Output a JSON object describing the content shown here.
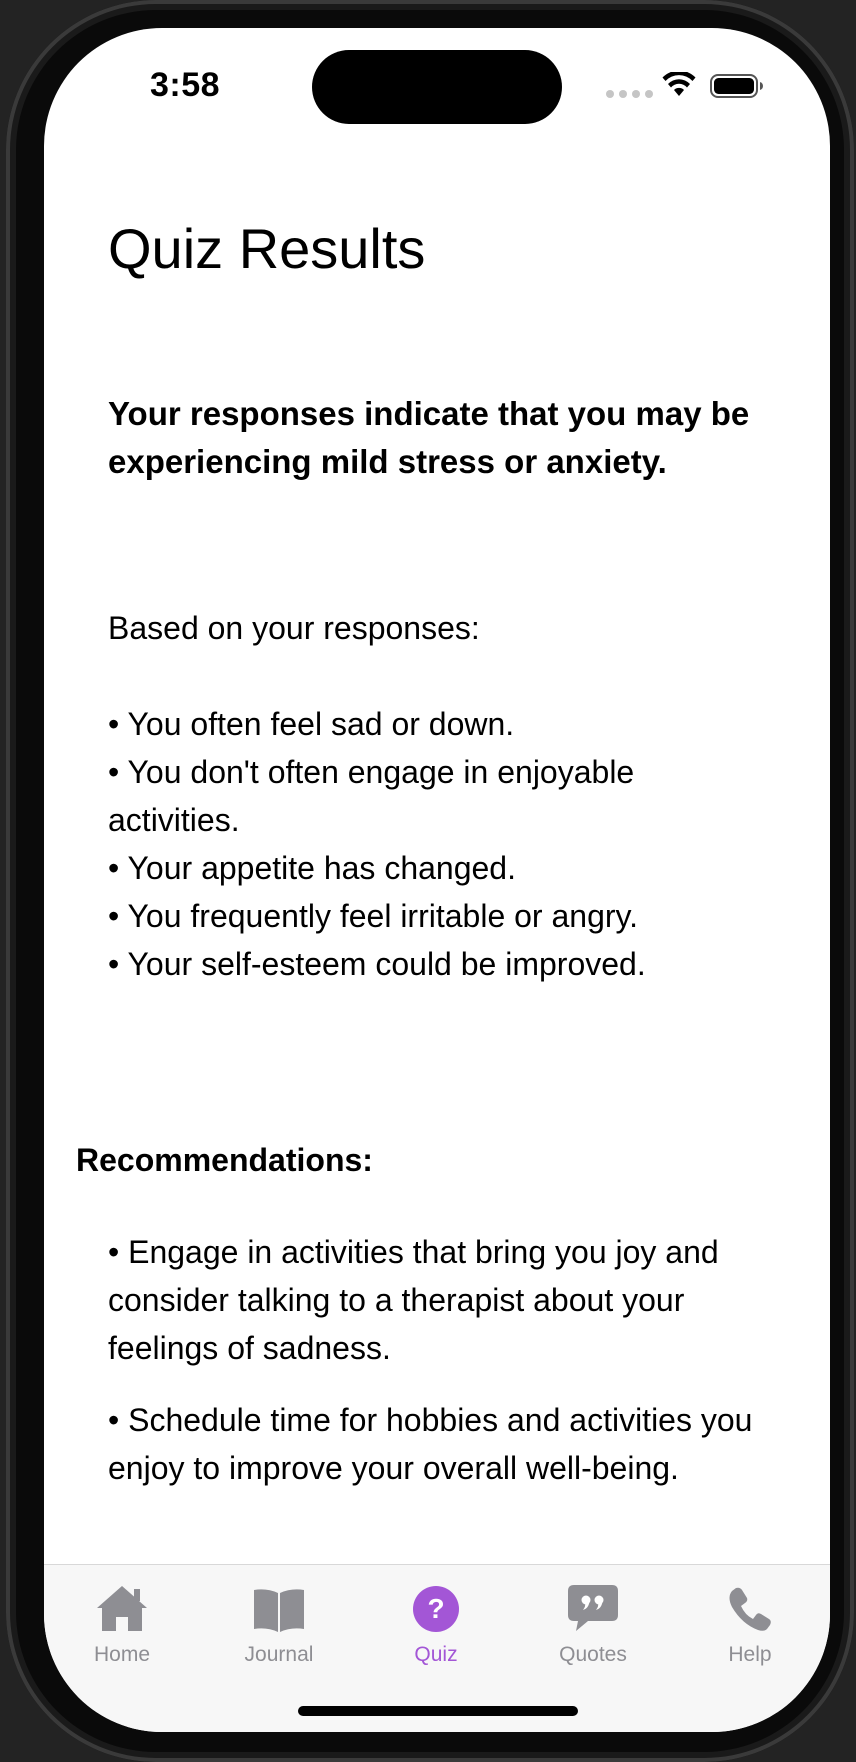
{
  "status_bar": {
    "time": "3:58"
  },
  "page": {
    "title": "Quiz Results",
    "headline": "Your responses indicate that you may be experiencing mild stress or anxiety.",
    "intro": "Based on your responses:",
    "findings": [
      "• You often feel sad or down.",
      "• You don't often engage in enjoyable activities.",
      "• Your appetite has changed.",
      "• You frequently feel irritable or angry.",
      "• Your self-esteem could be improved."
    ],
    "recommendations_heading": "Recommendations:",
    "recommendations": [
      "• Engage in activities that bring you joy and consider talking to a therapist about your feelings of sadness.",
      "• Schedule time for hobbies and activities you enjoy to improve your overall well-being."
    ]
  },
  "tab_bar": {
    "tabs": [
      {
        "label": "Home",
        "icon": "house-icon",
        "active": false
      },
      {
        "label": "Journal",
        "icon": "book-icon",
        "active": false
      },
      {
        "label": "Quiz",
        "icon": "question-circle-icon",
        "active": true
      },
      {
        "label": "Quotes",
        "icon": "quote-bubble-icon",
        "active": false
      },
      {
        "label": "Help",
        "icon": "phone-icon",
        "active": false
      }
    ]
  },
  "colors": {
    "accent": "#a356d6",
    "inactive_tab": "#8e8e93",
    "text": "#000000",
    "background": "#ffffff"
  }
}
